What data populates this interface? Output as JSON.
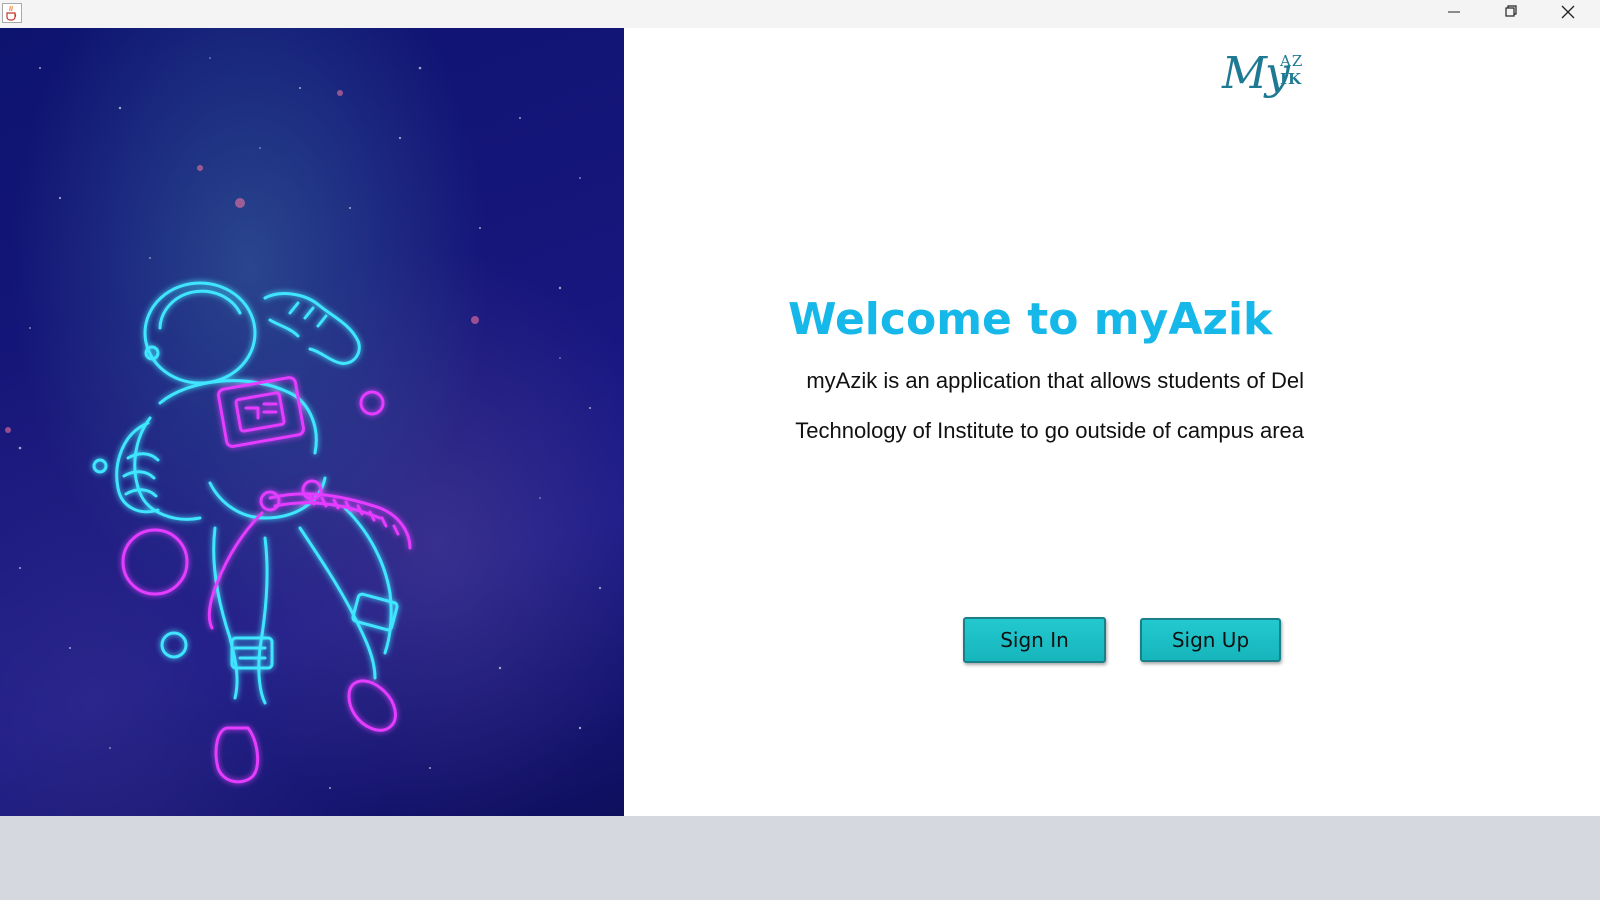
{
  "window": {
    "app_icon": "java-cup-icon",
    "controls": [
      "minimize-icon",
      "restore-icon",
      "close-icon"
    ]
  },
  "logo": {
    "my": "My",
    "az": "AZ",
    "ik": "IK"
  },
  "welcome": {
    "title": "Welcome to myAzik",
    "line1": "myAzik is an application that allows students of Del",
    "line2": "Technology of Institute to go outside of campus area"
  },
  "buttons": {
    "sign_in": "Sign In",
    "sign_up": "Sign Up"
  },
  "colors": {
    "title": "#15b8e8",
    "button": "#1ebfc6",
    "logo": "#1e7a93",
    "neon_cyan": "#3fe6ff",
    "neon_magenta": "#e43cff"
  }
}
